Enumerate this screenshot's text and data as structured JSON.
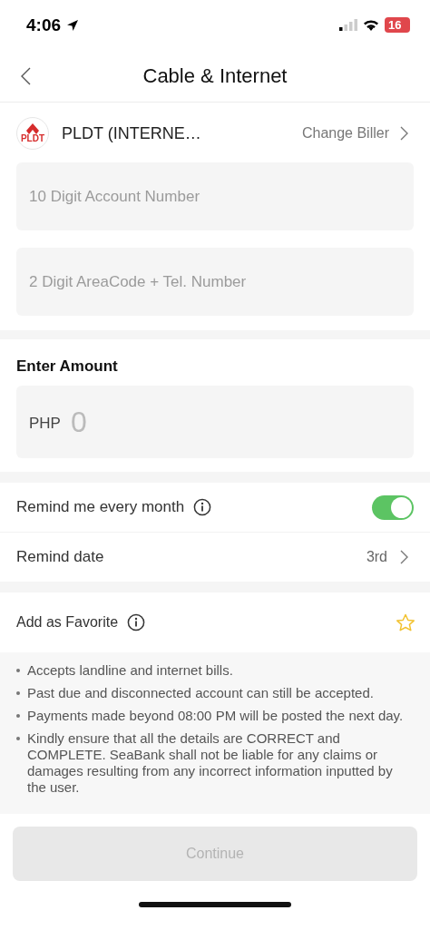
{
  "status_bar": {
    "time": "4:06",
    "battery": "16"
  },
  "header": {
    "title": "Cable & Internet"
  },
  "biller": {
    "logo_text": "PLDT",
    "name": "PLDT (INTERNE…",
    "action": "Change Biller"
  },
  "fields": [
    {
      "placeholder": "10 Digit Account Number"
    },
    {
      "placeholder": "2 Digit AreaCode + Tel. Number"
    }
  ],
  "amount": {
    "label": "Enter Amount",
    "currency": "PHP",
    "placeholder": "0"
  },
  "reminder": [
    {
      "kind": "toggle",
      "label": "Remind me every month",
      "info": true,
      "on": true
    },
    {
      "kind": "link",
      "label": "Remind date",
      "value": "3rd"
    }
  ],
  "favorite": {
    "label": "Add as Favorite",
    "info": true,
    "starred": false
  },
  "notes": [
    "Accepts landline and internet bills.",
    "Past due and disconnected account can still be accepted.",
    "Payments made beyond 08:00 PM will be posted the next day.",
    "Kindly ensure that all the details are CORRECT and COMPLETE. SeaBank shall not be liable for any claims or damages resulting from any incorrect information inputted by the user."
  ],
  "continue_button": {
    "label": "Continue",
    "disabled": true
  }
}
